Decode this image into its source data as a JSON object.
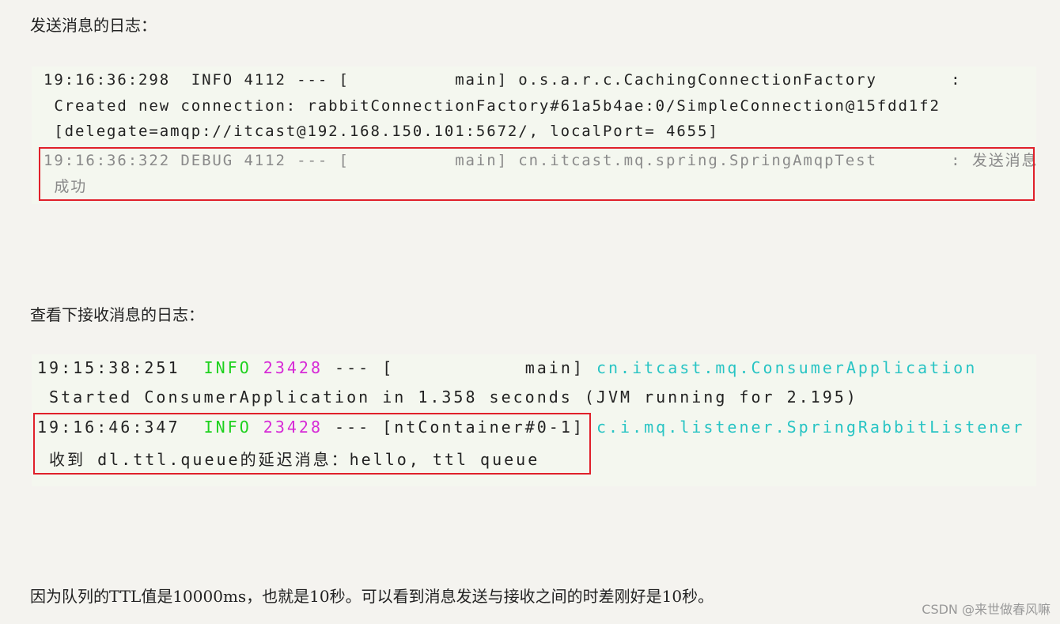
{
  "intro_send": "发送消息的日志：",
  "send_log": {
    "l1": "19:16:36:298  INFO 4112 --- [          main] o.s.a.r.c.CachingConnectionFactory       :",
    "l2": " Created new connection: rabbitConnectionFactory#61a5b4ae:0/SimpleConnection@15fdd1f2",
    "l3": " [delegate=amqp://itcast@192.168.150.101:5672/, localPort= 4655]",
    "l4": "19:16:36:322 DEBUG 4112 --- [          main] cn.itcast.mq.spring.SpringAmqpTest       : 发送消息",
    "l5": " 成功"
  },
  "intro_receive": "查看下接收消息的日志：",
  "receive_log": {
    "r1": {
      "time": "19:15:38:251  ",
      "level": "INFO",
      "pid": " 23428",
      "thread": " --- [           main] ",
      "logger": "cn.itcast.mq.ConsumerApplication"
    },
    "r2": " Started ConsumerApplication in 1.358 seconds (JVM running for 2.195)",
    "r3": {
      "time": "19:16:46:347  ",
      "level": "INFO",
      "pid": " 23428",
      "thread": " --- [ntContainer#0-1] ",
      "logger": "c.i.mq.listener.SpringRabbitListener"
    },
    "r4": " 收到 dl.ttl.queue的延迟消息：hello, ttl queue"
  },
  "conclusion": "因为队列的TTL值是10000ms，也就是10秒。可以看到消息发送与接收之间的时差刚好是10秒。",
  "watermark": "CSDN @来世做春风嘛",
  "colors": {
    "highlight": "#e0202a",
    "info": "#1ed11e",
    "pid": "#d62ad6",
    "logger": "#28c4c4"
  }
}
